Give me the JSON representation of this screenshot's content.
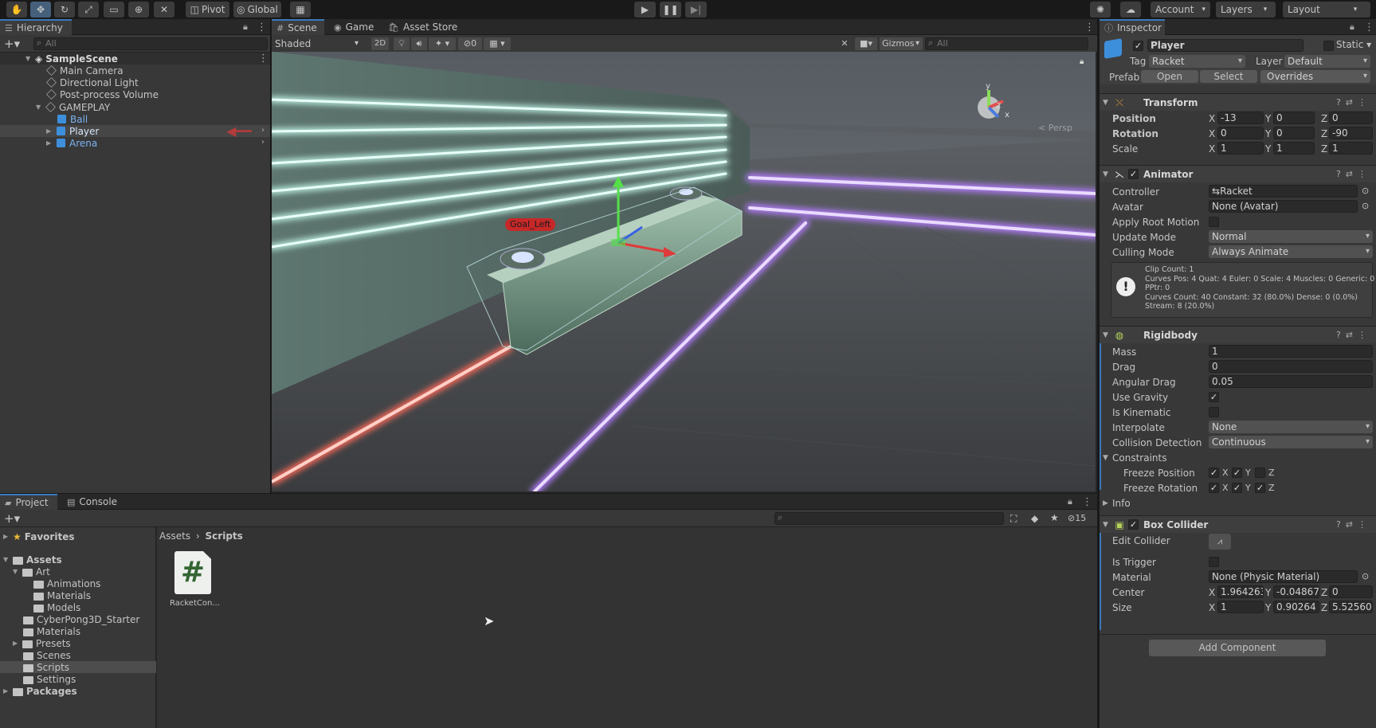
{
  "toolbar": {
    "pivot_label": "Pivot",
    "global_label": "Global",
    "account_label": "Account",
    "layers_label": "Layers",
    "layout_label": "Layout"
  },
  "hierarchy": {
    "tab_label": "Hierarchy",
    "search_placeholder": "All",
    "scene_name": "SampleScene",
    "items": [
      {
        "label": "Main Camera"
      },
      {
        "label": "Directional Light"
      },
      {
        "label": "Post-process Volume"
      },
      {
        "label": "GAMEPLAY"
      },
      {
        "label": "Ball"
      },
      {
        "label": "Player"
      },
      {
        "label": "Arena"
      }
    ]
  },
  "scene": {
    "tabs": [
      {
        "label": "Scene"
      },
      {
        "label": "Game"
      },
      {
        "label": "Asset Store"
      }
    ],
    "shading_mode": "Shaded",
    "mode_2d": "2D",
    "hidden_count": "0",
    "gizmos_label": "Gizmos",
    "search_placeholder": "All",
    "goal_label": "Goal_Left",
    "persp_label": "< Persp"
  },
  "project": {
    "tabs": [
      {
        "label": "Project"
      },
      {
        "label": "Console"
      }
    ],
    "hidden_count": "15",
    "breadcrumb_root": "Assets",
    "breadcrumb_current": "Scripts",
    "favorites_label": "Favorites",
    "tree": [
      {
        "label": "Assets"
      },
      {
        "label": "Art"
      },
      {
        "label": "Animations"
      },
      {
        "label": "Materials"
      },
      {
        "label": "Models"
      },
      {
        "label": "CyberPong3D_Starter"
      },
      {
        "label": "Materials"
      },
      {
        "label": "Presets"
      },
      {
        "label": "Scenes"
      },
      {
        "label": "Scripts"
      },
      {
        "label": "Settings"
      },
      {
        "label": "Packages"
      }
    ],
    "file_name": "RacketCon...",
    "file_glyph": "#"
  },
  "inspector": {
    "tab_label": "Inspector",
    "object_name": "Player",
    "static_label": "Static",
    "tag_label": "Tag",
    "tag_value": "Racket",
    "layer_label": "Layer",
    "layer_value": "Default",
    "prefab_label": "Prefab",
    "open_label": "Open",
    "select_label": "Select",
    "overrides_label": "Overrides",
    "transform": {
      "title": "Transform",
      "position_label": "Position",
      "rotation_label": "Rotation",
      "scale_label": "Scale",
      "axis_x": "X",
      "axis_y": "Y",
      "axis_z": "Z",
      "position": [
        "-13",
        "0",
        "0"
      ],
      "rotation": [
        "0",
        "0",
        "-90"
      ],
      "scale": [
        "1",
        "1",
        "1"
      ]
    },
    "animator": {
      "title": "Animator",
      "controller_label": "Controller",
      "controller_value": "Racket",
      "avatar_label": "Avatar",
      "avatar_value": "None (Avatar)",
      "apply_root_motion_label": "Apply Root Motion",
      "update_mode_label": "Update Mode",
      "update_mode_value": "Normal",
      "culling_mode_label": "Culling Mode",
      "culling_mode_value": "Always Animate",
      "info_lines": [
        "Clip Count: 1",
        "Curves Pos: 4 Quat: 4 Euler: 0 Scale: 4 Muscles: 0 Generic: 0",
        "PPtr: 0",
        "Curves Count: 40 Constant: 32 (80.0%) Dense: 0 (0.0%)",
        "Stream: 8 (20.0%)"
      ]
    },
    "rigidbody": {
      "title": "Rigidbody",
      "mass_label": "Mass",
      "mass_value": "1",
      "drag_label": "Drag",
      "drag_value": "0",
      "angular_drag_label": "Angular Drag",
      "angular_drag_value": "0.05",
      "use_gravity_label": "Use Gravity",
      "is_kinematic_label": "Is Kinematic",
      "interpolate_label": "Interpolate",
      "interpolate_value": "None",
      "collision_label": "Collision Detection",
      "collision_value": "Continuous",
      "constraints_label": "Constraints",
      "freeze_position_label": "Freeze Position",
      "freeze_rotation_label": "Freeze Rotation",
      "info_label": "Info"
    },
    "box_collider": {
      "title": "Box Collider",
      "edit_collider_label": "Edit Collider",
      "is_trigger_label": "Is Trigger",
      "material_label": "Material",
      "material_value": "None (Physic Material)",
      "center_label": "Center",
      "size_label": "Size",
      "center": [
        "1.964263",
        "-0.04867",
        "0"
      ],
      "size": [
        "1",
        "0.90264",
        "5.525604"
      ]
    },
    "add_component_label": "Add Component"
  },
  "colors": {
    "accent_blue": "#3a79bb",
    "panel_bg": "#383838",
    "neon_green": "#7fffd4",
    "neon_purple": "#b47cff",
    "neon_red": "#ff6a5a",
    "goal_label_bg": "#c62828"
  }
}
